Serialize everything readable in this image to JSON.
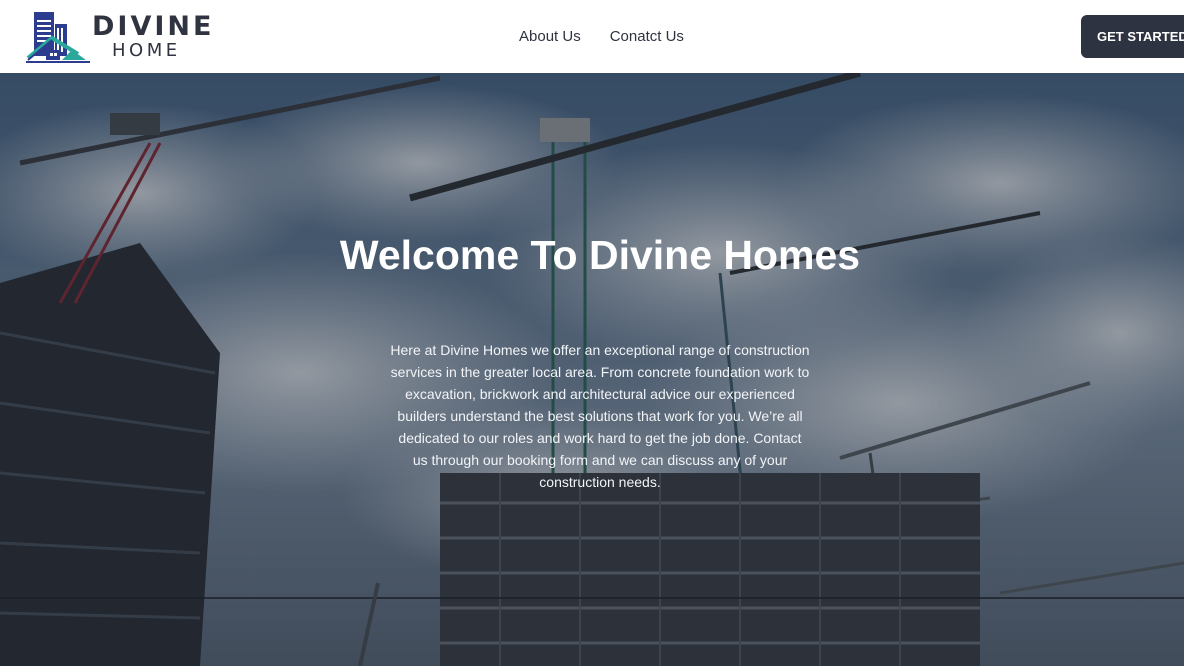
{
  "brand": {
    "name_line1": "DIVINE",
    "name_line2": "HOME",
    "logo_icon": "building-house-icon"
  },
  "nav": {
    "items": [
      {
        "label": "About Us"
      },
      {
        "label": "Conatct Us"
      }
    ]
  },
  "cta": {
    "label": "GET STARTED"
  },
  "hero": {
    "background": "construction-cranes-photo",
    "title": "Welcome To Divine Homes",
    "text": "Here at Divine Homes we offer an exceptional range of construction services in the greater local area. From concrete foundation work to excavation, brickwork and architectural advice our experienced builders understand the best solutions that work for you. We’re all dedicated to our roles and work hard to get the job done. Contact us through our booking form and we can discuss any of your construction needs."
  },
  "colors": {
    "brand_dark": "#2d3340",
    "logo_blue": "#2c3d8f",
    "logo_teal": "#2aa89b",
    "header_bg": "#ffffff"
  }
}
